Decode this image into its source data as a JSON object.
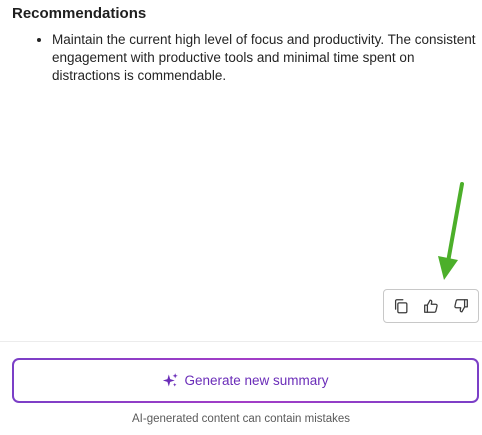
{
  "recommendations": {
    "heading": "Recommendations",
    "items": [
      "Maintain the current high level of focus and productivity. The consistent engagement with productive tools and minimal time spent on distractions is commendable."
    ]
  },
  "feedback": {
    "buttons": [
      {
        "icon": "copy-icon"
      },
      {
        "icon": "thumbs-up-icon"
      },
      {
        "icon": "thumbs-down-icon"
      }
    ]
  },
  "annotation": {
    "icon": "green-arrow",
    "color": "#4caf2a"
  },
  "generate": {
    "label": "Generate new summary",
    "icon": "sparkle-icon",
    "accent_color": "#6a2cb8"
  },
  "disclaimer": "AI-generated content can contain mistakes"
}
